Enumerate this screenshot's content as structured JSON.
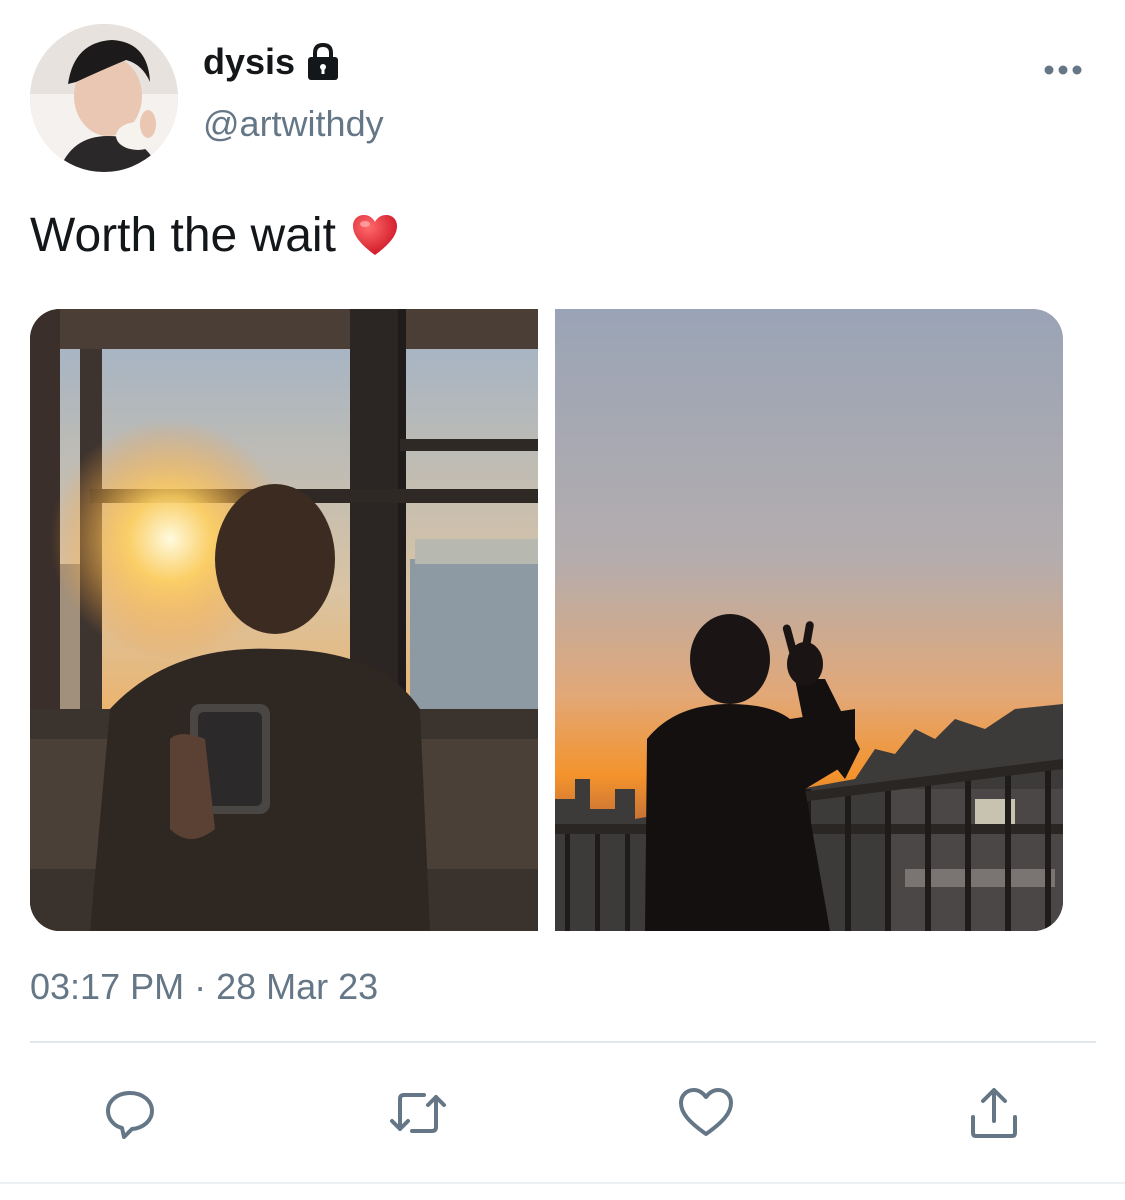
{
  "user": {
    "display_name": "dysis",
    "handle": "@artwithdy",
    "verified_icon": "lock-icon"
  },
  "tweet": {
    "text": "Worth the wait",
    "emoji": "heart-emoji",
    "timestamp": "03:17 PM · 28 Mar 23"
  },
  "actions": [
    {
      "icon": "reply-icon"
    },
    {
      "icon": "retweet-icon"
    },
    {
      "icon": "like-icon"
    },
    {
      "icon": "share-icon"
    }
  ],
  "colors": {
    "text": "#14171a",
    "secondary": "#657786",
    "divider": "#e1e8ed",
    "heart": "#e0245e"
  }
}
